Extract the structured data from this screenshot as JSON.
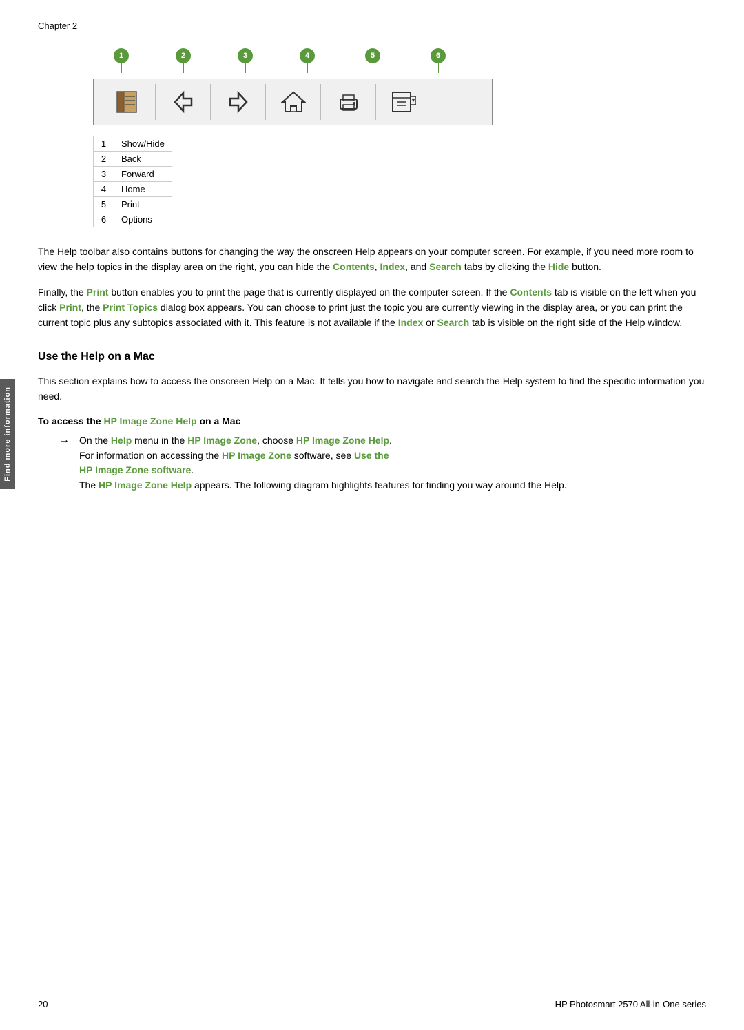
{
  "chapter": {
    "label": "Chapter 2"
  },
  "toolbar_diagram": {
    "numbers": [
      "1",
      "2",
      "3",
      "4",
      "5",
      "6"
    ],
    "icons": [
      {
        "name": "show-hide-icon",
        "label": "≡"
      },
      {
        "name": "back-icon",
        "label": "←"
      },
      {
        "name": "forward-icon",
        "label": "→"
      },
      {
        "name": "home-icon",
        "label": "⌂"
      },
      {
        "name": "print-icon",
        "label": "🖨"
      },
      {
        "name": "options-icon",
        "label": "📋"
      }
    ]
  },
  "legend": [
    {
      "num": "1",
      "label": "Show/Hide"
    },
    {
      "num": "2",
      "label": "Back"
    },
    {
      "num": "3",
      "label": "Forward"
    },
    {
      "num": "4",
      "label": "Home"
    },
    {
      "num": "5",
      "label": "Print"
    },
    {
      "num": "6",
      "label": "Options"
    }
  ],
  "paragraphs": {
    "p1": "The Help toolbar also contains buttons for changing the way the onscreen Help appears on your computer screen. For example, if you need more room to view the help topics in the display area on the right, you can hide the ",
    "p1_links": [
      "Contents",
      "Index"
    ],
    "p1_mid": ", and ",
    "p1_search": "Search",
    "p1_end": " tabs by clicking the ",
    "p1_hide": "Hide",
    "p1_final": " button.",
    "p2_start": "Finally, the ",
    "p2_print": "Print",
    "p2_mid": " button enables you to print the page that is currently displayed on the computer screen. If the ",
    "p2_contents": "Contents",
    "p2_mid2": " tab is visible on the left when you click ",
    "p2_print2": "Print",
    "p2_mid3": ", the ",
    "p2_print_topics": "Print Topics",
    "p2_mid4": " dialog box appears. You can choose to print just the topic you are currently viewing in the display area, or you can print the current topic plus any subtopics associated with it. This feature is not available if the ",
    "p2_index": "Index",
    "p2_mid5": " or ",
    "p2_search2": "Search",
    "p2_end": " tab is visible on the right side of the Help window."
  },
  "section": {
    "heading": "Use the Help on a Mac",
    "intro": "This section explains how to access the onscreen Help on a Mac. It tells you how to navigate and search the Help system to find the specific information you need.",
    "sub_heading": "To access the HP Image Zone Help on a Mac",
    "arrow_item_part1": "On the ",
    "arrow_help": "Help",
    "arrow_mid1": " menu in the ",
    "arrow_hp1": "HP Image Zone",
    "arrow_mid2": ", choose ",
    "arrow_hp2": "HP Image Zone Help",
    "arrow_end1": ".",
    "arrow_line2_start": "For information on accessing the ",
    "arrow_hp3": "HP Image Zone",
    "arrow_line2_mid": " software, see ",
    "arrow_use_link": "Use the HP Image Zone software",
    "arrow_line2_end": ".",
    "arrow_line3_start": "The ",
    "arrow_hp4": "HP Image Zone Help",
    "arrow_line3_end": " appears. The following diagram highlights features for finding you way around the Help."
  },
  "footer": {
    "page_num": "20",
    "product": "HP Photosmart 2570 All-in-One series"
  },
  "side_tab": {
    "text": "Find more information"
  }
}
